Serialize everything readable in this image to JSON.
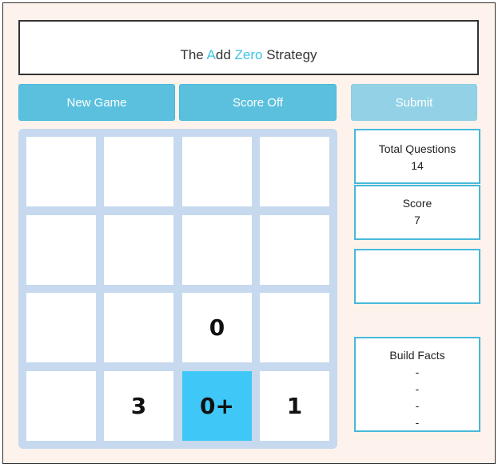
{
  "title": {
    "prefix": "The ",
    "accent1": "A",
    "mid": "dd ",
    "accent2": "Zero",
    "suffix": " Strategy"
  },
  "buttons": {
    "new_game": "New Game",
    "score_toggle": "Score Off",
    "submit": "Submit"
  },
  "board": [
    [
      "",
      "",
      "",
      ""
    ],
    [
      "",
      "",
      "",
      ""
    ],
    [
      "",
      "",
      "0",
      ""
    ],
    [
      "",
      "3",
      "0+",
      "1"
    ]
  ],
  "stats": {
    "total_questions_label": "Total Questions",
    "total_questions_value": "14",
    "score_label": "Score",
    "score_value": "7"
  },
  "build_facts": {
    "label": "Build Facts",
    "items": [
      "-",
      "-",
      "-",
      "-"
    ]
  },
  "colors": {
    "accent": "#3ec3e6",
    "button": "#5bc0de",
    "active_tile": "#3fc8f7",
    "board": "#c6d9ee"
  }
}
